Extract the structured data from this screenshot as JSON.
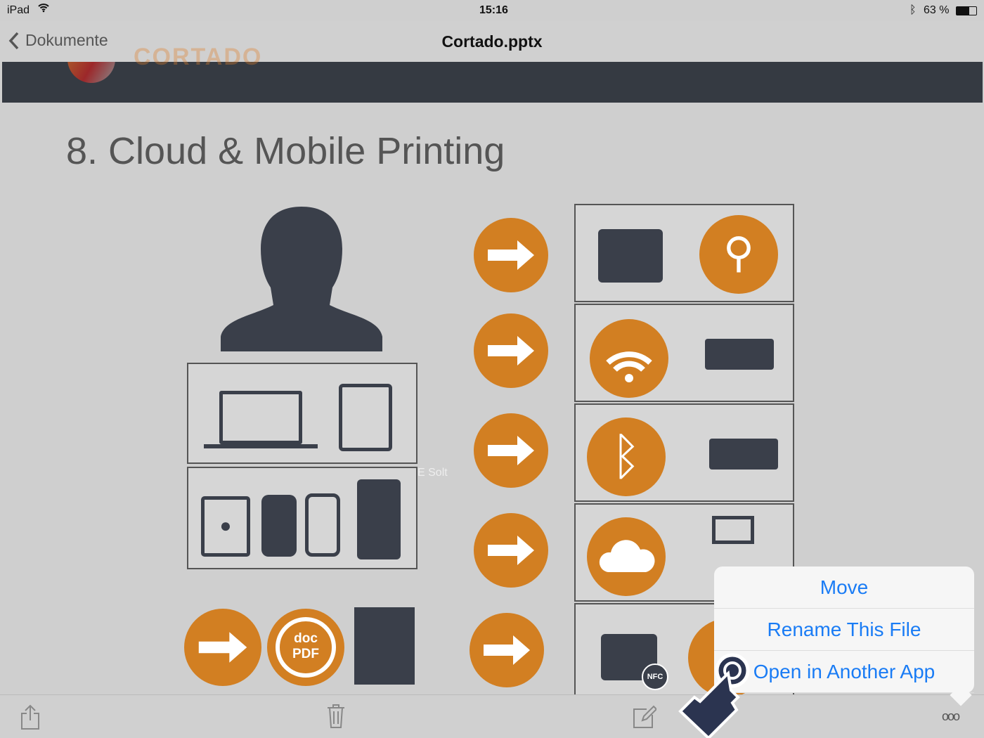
{
  "status": {
    "device": "iPad",
    "time": "15:16",
    "battery": "63 %"
  },
  "nav": {
    "back_label": "Dokumente",
    "title": "Cortado.pptx"
  },
  "slide": {
    "logo_text": "CORTADO",
    "heading": "8. Cloud & Mobile Printing",
    "doc_label": "doc",
    "pdf_label": "PDF",
    "nfc_label": "NFC",
    "watermark": "E Solt"
  },
  "popup": {
    "items": [
      "Move",
      "Rename This File",
      "Open in Another App"
    ]
  },
  "colors": {
    "accent": "#1a7cf5",
    "orange": "#d27f22",
    "dark": "#353a42"
  }
}
